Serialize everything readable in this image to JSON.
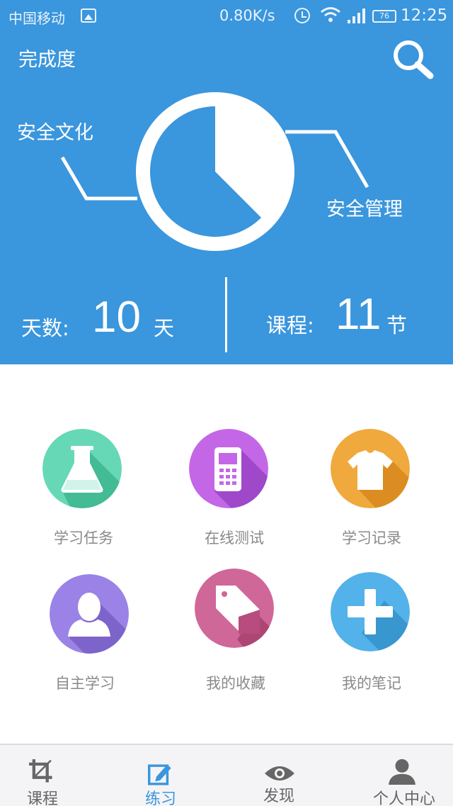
{
  "status_bar": {
    "carrier": "中国移动",
    "speed": "0.80K/s",
    "battery": "76",
    "time": "12:25"
  },
  "header": {
    "title": "完成度"
  },
  "completion_chart": {
    "left_label": "安全文化",
    "right_label": "安全管理",
    "inner_fraction": 0.375,
    "colors": {
      "background": "#3a96dd",
      "pie": "#ffffff"
    }
  },
  "stats": {
    "days_label": "天数:",
    "days_value": "10",
    "days_unit": "天",
    "courses_label": "课程:",
    "courses_value": "11",
    "courses_unit": "节"
  },
  "grid": [
    {
      "label": "学习任务",
      "icon": "flask-icon",
      "color": "#66d8b6"
    },
    {
      "label": "在线测试",
      "icon": "mobile-phone-icon",
      "color": "#c467e6"
    },
    {
      "label": "学习记录",
      "icon": "tshirt-icon",
      "color": "#f0a93c"
    },
    {
      "label": "自主学习",
      "icon": "person-icon",
      "color": "#9a82e6"
    },
    {
      "label": "我的收藏",
      "icon": "tag-icon",
      "color": "#cf6799"
    },
    {
      "label": "我的笔记",
      "icon": "plus-icon",
      "color": "#53b2ea"
    }
  ],
  "bottom_nav": [
    {
      "label": "课程",
      "icon": "crop-icon",
      "active": false
    },
    {
      "label": "练习",
      "icon": "edit-icon",
      "active": true
    },
    {
      "label": "发现",
      "icon": "eye-icon",
      "active": false
    },
    {
      "label": "个人中心",
      "icon": "user-icon",
      "active": false
    }
  ]
}
